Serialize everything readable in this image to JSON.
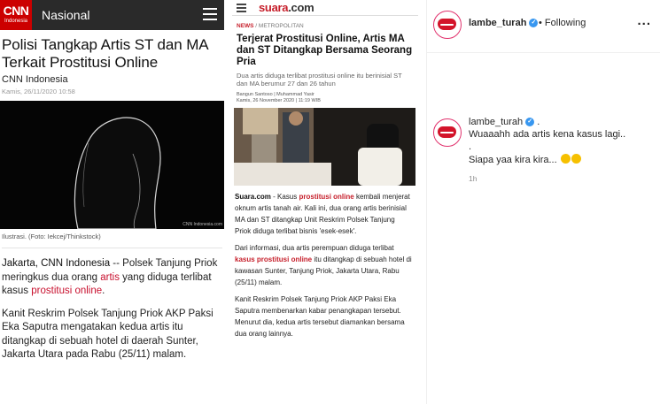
{
  "cnn": {
    "logo_text": "CNN",
    "logo_sub": "Indonesia",
    "section": "Nasional",
    "title": "Polisi Tangkap Artis ST dan MA Terkait Prostitusi Online",
    "source": "CNN Indonesia",
    "date": "Kamis, 26/11/2020 10:58",
    "photo_credit": "CNN Indonesia.com",
    "caption": "Ilustrasi. (Foto: Iekcej/Thinkstock)",
    "p1_bold": "Jakarta, CNN Indonesia",
    "p1_a": " -- Polsek Tanjung Priok meringkus dua orang ",
    "p1_link1": "artis",
    "p1_b": " yang diduga terlibat kasus ",
    "p1_link2": "prostitusi online",
    "p1_c": ".",
    "p2": "Kanit Reskrim Polsek Tanjung Priok AKP Paksi Eka Saputra mengatakan kedua artis itu ditangkap di sebuah hotel di daerah Sunter, Jakarta Utara pada Rabu (25/11) malam."
  },
  "suara": {
    "logo": "suara",
    "logo_suffix": ".com",
    "crumb_a": "NEWS",
    "crumb_b": " / METROPOLITAN",
    "title": "Terjerat Prostitusi Online, Artis MA dan ST Ditangkap Bersama Seorang Pria",
    "lead": "Dua artis diduga terlibat prostitusi online itu berinisial ST dan MA berumur 27 dan 26 tahun",
    "author": "Bangun Santoso | Muhammad Yasir",
    "date": "Kamis, 26 November 2020 | 11:19 WIB",
    "p1_bold": "Suara.com",
    "p1_a": " - Kasus ",
    "p1_link": "prostitusi online",
    "p1_b": " kembali menjerat oknum artis tanah air. Kali ini, dua orang artis berinisial MA dan ST ditangkap Unit Reskrim Polsek Tanjung Priok diduga terlibat bisnis 'esek-esek'.",
    "p2_a": "Dari informasi, dua artis perempuan diduga terlibat ",
    "p2_link": "kasus prostitusi online",
    "p2_b": " itu ditangkap di sebuah hotel di kawasan Sunter, Tanjung Priok, Jakarta Utara, Rabu (25/11) malam.",
    "p3": "Kanit Reskrim Polsek Tanjung Priok AKP Paksi Eka Saputra membenarkan kabar penangkapan tersebut. Menurut dia, kedua artis tersebut diamankan bersama dua orang lainnya."
  },
  "instagram": {
    "username": "lambe_turah",
    "following": "Following",
    "more": "...",
    "comment_line1": "Wuaaahh ada artis kena kasus lagi..",
    "comment_line2": ".",
    "comment_line3": "Siapa yaa kira kira...",
    "time": "1h"
  },
  "colors": {
    "cnn_red": "#cc0000",
    "suara_red": "#c61e2a",
    "ig_blue": "#3897f0"
  }
}
